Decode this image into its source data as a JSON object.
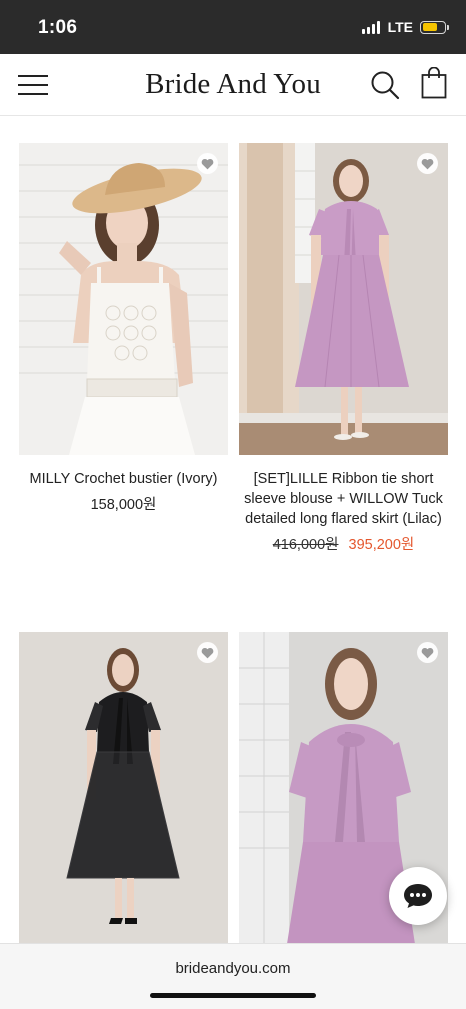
{
  "status_bar": {
    "time": "1:06",
    "network": "LTE",
    "battery_color": "#f5c400"
  },
  "header": {
    "brand": "Bride And You",
    "menu_icon": "hamburger-menu-icon",
    "search_icon": "search-icon",
    "cart_icon": "shopping-bag-icon"
  },
  "products": [
    {
      "name": "MILLY Crochet bustier (Ivory)",
      "price": "158,000원",
      "image": "model-in-straw-hat-and-white-crochet-bustier"
    },
    {
      "name": "[SET]LILLE Ribbon tie short sleeve blouse + WILLOW Tuck detailed long flared skirt (Lilac)",
      "price_original": "416,000원",
      "price_sale": "395,200원",
      "image": "model-in-lilac-blouse-and-long-skirt"
    },
    {
      "name": "",
      "image": "model-in-black-bow-tie-dress"
    },
    {
      "name": "",
      "image": "model-in-lilac-bow-tie-blouse"
    }
  ],
  "colors": {
    "sale_price": "#e4572e",
    "status_bar_bg": "#2b2b2b"
  },
  "chat": {
    "icon": "chat-bubble-icon"
  },
  "browser_bar": {
    "url": "brideandyou.com"
  }
}
